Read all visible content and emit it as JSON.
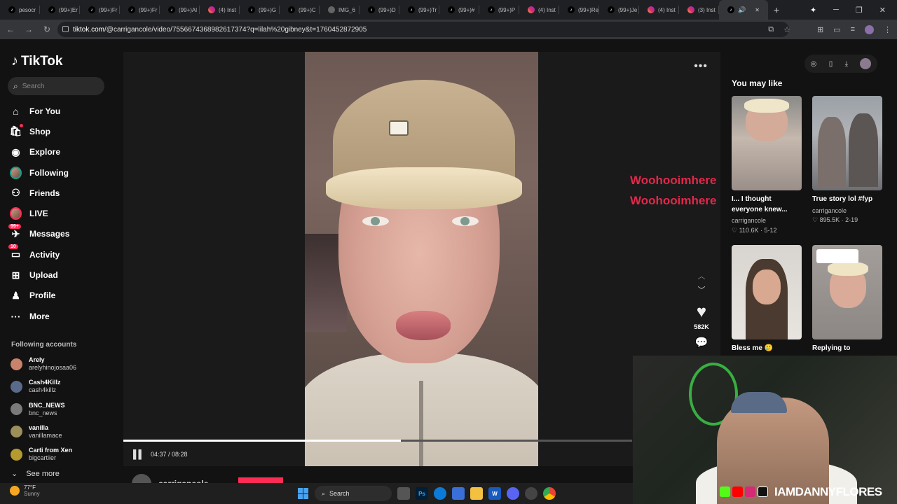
{
  "browser": {
    "tabs": [
      {
        "label": "pesocr",
        "icon": "tiktok-icon"
      },
      {
        "label": "(99+)Er",
        "icon": "tiktok-icon"
      },
      {
        "label": "(99+)Fr",
        "icon": "tiktok-icon"
      },
      {
        "label": "(99+)Fr",
        "icon": "tiktok-icon"
      },
      {
        "label": "(99+)Al",
        "icon": "tiktok-icon"
      },
      {
        "label": "(4) Inst",
        "icon": "instagram-icon"
      },
      {
        "label": "(99+)G",
        "icon": "tiktok-icon"
      },
      {
        "label": "(99+)C",
        "icon": "tiktok-icon"
      },
      {
        "label": "IMG_6",
        "icon": "globe-icon"
      },
      {
        "label": "(99+)D",
        "icon": "tiktok-icon"
      },
      {
        "label": "(99+)Tr",
        "icon": "tiktok-icon"
      },
      {
        "label": "(99+)#",
        "icon": "tiktok-icon"
      },
      {
        "label": "(99+)P",
        "icon": "tiktok-icon"
      },
      {
        "label": "(4) Inst",
        "icon": "instagram-icon"
      },
      {
        "label": "(99+)Re",
        "icon": "tiktok-icon"
      },
      {
        "label": "(99+)Je",
        "icon": "tiktok-icon"
      },
      {
        "label": "(4) Inst",
        "icon": "instagram-icon"
      },
      {
        "label": "(3) Inst",
        "icon": "instagram-icon"
      }
    ],
    "url_prefix": "tiktok.com",
    "url_rest": "/@carrigancole/video/7556674368982617374?q=lilah%20gibney&t=1760452872905"
  },
  "sidebar": {
    "brand": "TikTok",
    "search_placeholder": "Search",
    "nav": [
      {
        "label": "For You",
        "icon": "home-icon"
      },
      {
        "label": "Shop",
        "icon": "shop-icon"
      },
      {
        "label": "Explore",
        "icon": "compass-icon"
      },
      {
        "label": "Following",
        "icon": "following-avatar"
      },
      {
        "label": "Friends",
        "icon": "friends-icon"
      },
      {
        "label": "LIVE",
        "icon": "live-avatar"
      },
      {
        "label": "Messages",
        "icon": "messages-icon",
        "badge": "99+"
      },
      {
        "label": "Activity",
        "icon": "activity-icon",
        "badge": "10"
      },
      {
        "label": "Upload",
        "icon": "upload-icon"
      },
      {
        "label": "Profile",
        "icon": "profile-icon"
      },
      {
        "label": "More",
        "icon": "more-icon"
      }
    ],
    "following_title": "Following accounts",
    "following": [
      {
        "name": "Arely",
        "handle": "arelyhinojosaa06",
        "color": "#c9826b"
      },
      {
        "name": "Cash4Killz",
        "handle": "cash4killz",
        "color": "#5a6a8a"
      },
      {
        "name": "BNC_NEWS",
        "handle": "bnc_news",
        "color": "#7a7a7a"
      },
      {
        "name": "vanilla",
        "handle": "vanillamace",
        "color": "#9c8f5a"
      },
      {
        "name": "Carti from Xen",
        "handle": "bigcartiier",
        "color": "#b59b2f"
      }
    ],
    "see_more": "See more"
  },
  "player": {
    "time": "04:37 / 08:28",
    "progress": 0.545,
    "likes": "582K",
    "overlay_lines": [
      "Woohooimhere",
      "Woohooimhere"
    ],
    "author": "carrigancole"
  },
  "recommend": {
    "title": "You may like",
    "items": [
      {
        "caption": "I... I thought everyone knew...",
        "user": "carrigancole",
        "stat": "110.6K · 5-12"
      },
      {
        "caption": "True story lol #fyp",
        "user": "carrigancole",
        "stat": "895.5K · 2-19"
      },
      {
        "caption": "Bless me 🥲",
        "user": "",
        "stat": ""
      },
      {
        "caption": "Replying to",
        "user": "",
        "stat": ""
      }
    ]
  },
  "webcam": {
    "name": "IAMDANNYFLORES"
  },
  "taskbar": {
    "temp": "77°F",
    "condition": "Sunny",
    "search": "Search"
  }
}
